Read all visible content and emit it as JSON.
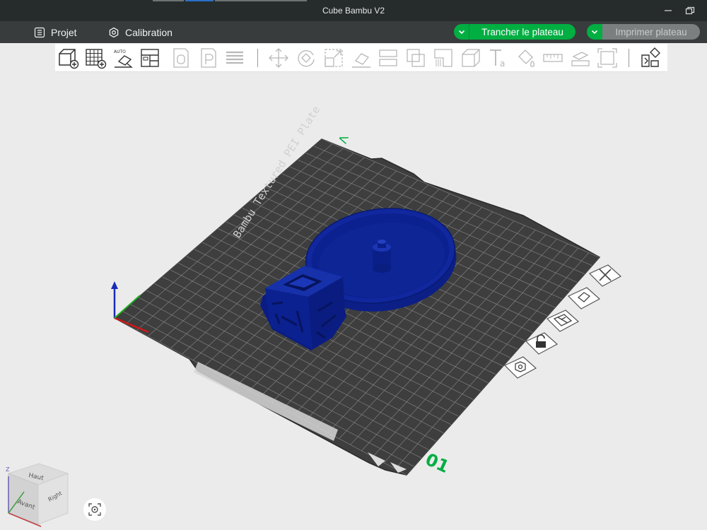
{
  "window": {
    "title": "Cube Bambu V2"
  },
  "menu": {
    "project_label": "Projet",
    "calibration_label": "Calibration",
    "slice_label": "Trancher le plateau",
    "print_label": "Imprimer plateau"
  },
  "toolbar": {
    "tools": [
      "add-object-icon",
      "add-plate-icon",
      "auto-orient-icon",
      "arrange-icon",
      "empty-plate-icon",
      "plate-settings-icon",
      "layers-icon",
      "move-icon",
      "rotate-icon",
      "scale-icon",
      "lay-on-face-icon",
      "cut-icon",
      "boolean-icon",
      "support-paint-icon",
      "seam-paint-icon",
      "text-icon",
      "color-paint-icon",
      "measure-icon",
      "assembly-icon",
      "fit-view-icon",
      "split-icon"
    ]
  },
  "plate": {
    "name": "Bambu Textured PEI Plate",
    "plate_number": "01",
    "top_mark": "V"
  },
  "view_cube": {
    "top_label": "Haut",
    "front_label": "Avant",
    "right_label": "Right",
    "axis_z": "Z"
  },
  "colors": {
    "accent": "#00ae42",
    "model": "#0a2396",
    "plate": "#3d3d3d"
  }
}
